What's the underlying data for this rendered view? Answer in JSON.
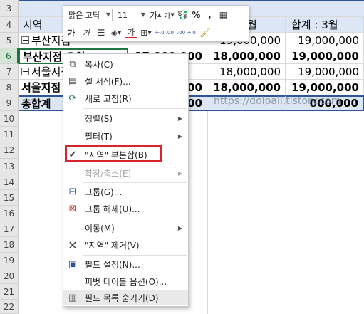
{
  "rows": [
    "3",
    "4",
    "5",
    "6",
    "7",
    "8",
    "9",
    "10",
    "11",
    "12",
    "13",
    "14",
    "15",
    "16",
    "17",
    "18",
    "19",
    "20",
    "21",
    "22"
  ],
  "cells": {
    "r4_region": "지역",
    "r4_month2": "월",
    "r4_total3": "합계 : 3월",
    "r5_label": "부산지점",
    "r5_v2": "19,000,000",
    "r5_v3": "19,000,000",
    "r6_label": "부산지점 요약",
    "r6_v1": "17,000,000",
    "r6_v2": "18,000,000",
    "r6_v3": "19,000,000",
    "r7_label": "서울지점",
    "r7_v2": "18,000,000",
    "r7_v3": "19,000,000",
    "r8_label": "서울지점 요약",
    "r8_v1": "000",
    "r8_v2": "18,000,000",
    "r8_v3": "19,000,000",
    "r9_label": "총합계",
    "r9_v1": "000",
    "r9_v3": "000,000"
  },
  "watermark": "https://dolpali.tistory.com",
  "mini_toolbar": {
    "font_name": "맑은 고딕",
    "font_size": "11",
    "percent": "%",
    "comma": ",",
    "grow_font": "가",
    "shrink_font": "가",
    "bold": "가",
    "italic": "가",
    "font_color_glyph": "가",
    "dec_increase": "←.0 .00",
    "dec_decrease": ".00 →.0"
  },
  "menu": {
    "copy": "복사(C)",
    "format_cells": "셀 서식(F)...",
    "refresh": "새로 고침(R)",
    "sort": "정렬(S)",
    "filter": "필터(T)",
    "subtotal": "\"지역\" 부분합(B)",
    "expand": "확장/축소(E)",
    "group": "그룹(G)...",
    "ungroup": "그룹 해제(U)...",
    "move": "이동(M)",
    "remove": "\"지역\" 제거(V)",
    "field_settings": "필드 설정(N)...",
    "pivot_options": "피벗 테이블 옵션(O)...",
    "hide_field_list": "필드 목록 숨기기(D)"
  },
  "colors": {
    "header_band": "#dce6f5",
    "highlight": "#d9232e",
    "table_border": "#2f5597"
  }
}
